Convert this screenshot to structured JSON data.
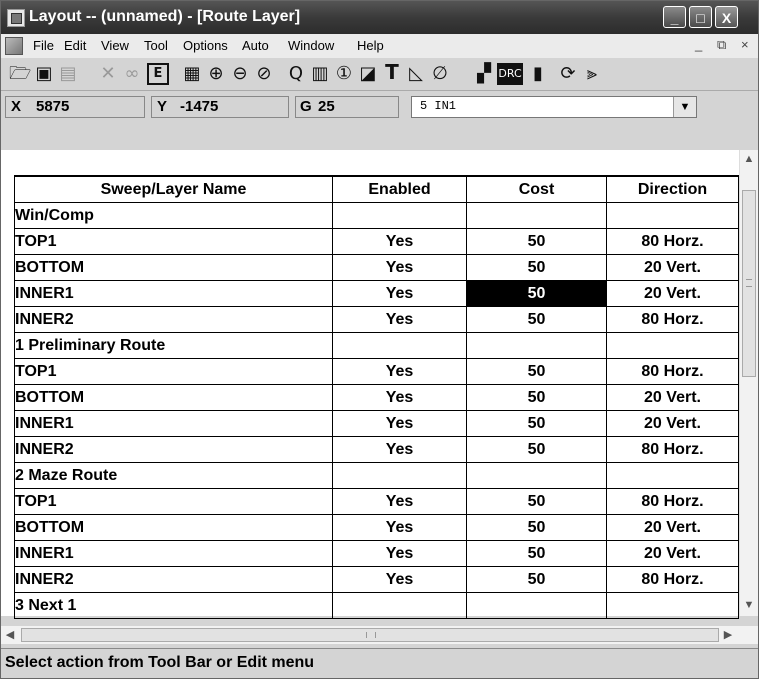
{
  "window": {
    "title": "Layout -- (unnamed) - [Route Layer]",
    "controls": [
      "_",
      "□",
      "X"
    ]
  },
  "menu": {
    "items": [
      "File",
      "Edit",
      "View",
      "Tool",
      "Options",
      "Auto",
      "Window",
      "Help"
    ],
    "mdi_controls": [
      "_",
      "⧉",
      "×"
    ]
  },
  "toolbar": {
    "icons": [
      "open-icon",
      "save-icon",
      "print-icon",
      "cross-icon",
      "binoculars-icon",
      "edit-icon",
      "grid-icon",
      "zoom-in-icon",
      "zoom-out-icon",
      "zoom-fit-icon",
      "query-icon",
      "pins-icon",
      "component-icon",
      "part-icon",
      "text-icon",
      "line-icon",
      "no-route-icon",
      "layers-icon",
      "drc-icon",
      "stack-icon",
      "route-icon",
      "via-icon"
    ],
    "drc_label": "DRC",
    "edit_label": "E",
    "text_label": "T"
  },
  "coords": {
    "x_label": "X",
    "x_value": "5875",
    "y_label": "Y",
    "y_value": "-1475",
    "g_label": "G",
    "g_value": "25",
    "layer_value": "5  IN1"
  },
  "table": {
    "headers": [
      "Sweep/Layer Name",
      "Enabled",
      "Cost",
      "Direction"
    ],
    "rows": [
      {
        "name": "Win/Comp",
        "enabled": "",
        "cost": "",
        "direction": "",
        "group": true
      },
      {
        "name": "TOP1",
        "enabled": "Yes",
        "cost": "50",
        "direction": "80 Horz."
      },
      {
        "name": "BOTTOM",
        "enabled": "Yes",
        "cost": "50",
        "direction": "20 Vert."
      },
      {
        "name": "INNER1",
        "enabled": "Yes",
        "cost": "50",
        "direction": "20 Vert.",
        "selected_cost": true
      },
      {
        "name": "INNER2",
        "enabled": "Yes",
        "cost": "50",
        "direction": "80 Horz."
      },
      {
        "name": "1 Preliminary Route",
        "enabled": "",
        "cost": "",
        "direction": "",
        "group": true
      },
      {
        "name": "TOP1",
        "enabled": "Yes",
        "cost": "50",
        "direction": "80 Horz."
      },
      {
        "name": "BOTTOM",
        "enabled": "Yes",
        "cost": "50",
        "direction": "20 Vert."
      },
      {
        "name": "INNER1",
        "enabled": "Yes",
        "cost": "50",
        "direction": "20 Vert."
      },
      {
        "name": "INNER2",
        "enabled": "Yes",
        "cost": "50",
        "direction": "80 Horz."
      },
      {
        "name": "2 Maze Route",
        "enabled": "",
        "cost": "",
        "direction": "",
        "group": true
      },
      {
        "name": "TOP1",
        "enabled": "Yes",
        "cost": "50",
        "direction": "80 Horz."
      },
      {
        "name": "BOTTOM",
        "enabled": "Yes",
        "cost": "50",
        "direction": "20 Vert."
      },
      {
        "name": "INNER1",
        "enabled": "Yes",
        "cost": "50",
        "direction": "20 Vert."
      },
      {
        "name": "INNER2",
        "enabled": "Yes",
        "cost": "50",
        "direction": "80 Horz."
      },
      {
        "name": "3 Next 1",
        "enabled": "",
        "cost": "",
        "direction": "",
        "group": true
      }
    ]
  },
  "status": {
    "text": "Select action from Tool Bar or Edit menu"
  },
  "colors": {
    "title_bar": "#3a3a3a",
    "selected_cell": "#000000",
    "chrome": "#d4d4d4"
  }
}
